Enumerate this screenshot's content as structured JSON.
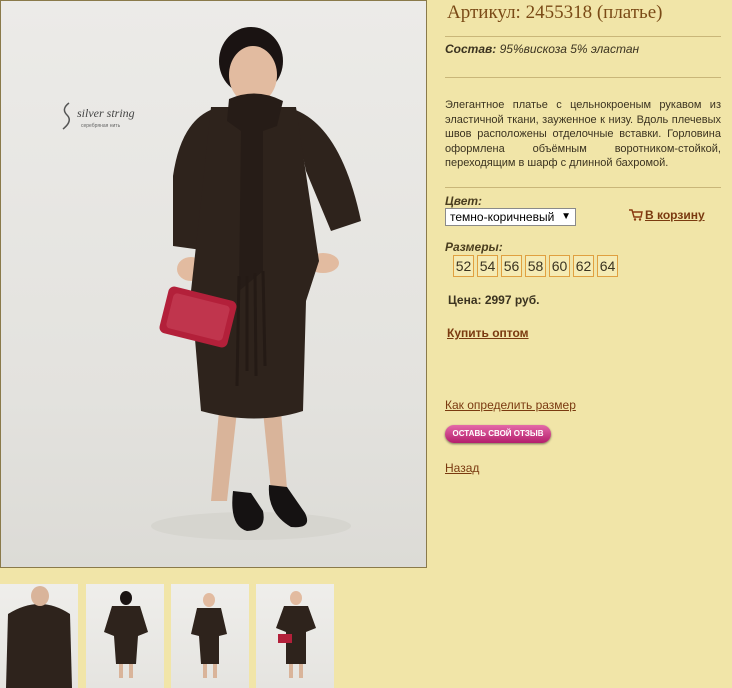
{
  "product": {
    "title": "Артикул: 2455318 (платье)",
    "composition_label": "Состав:",
    "composition_value": "95%вискоза 5% эластан",
    "description": "Элегантное платье с цельнокроеным рукавом из эластичной ткани, зауженное к низу. Вдоль плечевых швов расположены отделочные вставки. Горловина оформлена объёмным воротником-стойкой, переходящим в шарф с длинной бахромой."
  },
  "color": {
    "label": "Цвет:",
    "selected": "темно-коричневый"
  },
  "cart": {
    "label": "В корзину",
    "icon": "cart-icon"
  },
  "sizes": {
    "label": "Размеры:",
    "values": [
      "52",
      "54",
      "56",
      "58",
      "60",
      "62",
      "64"
    ]
  },
  "price": {
    "text": "Цена: 2997 руб."
  },
  "links": {
    "buy_wholesale": "Купить оптом",
    "size_guide": "Как определить размер",
    "review_button": "ОСТАВЬ СВОЙ ОТЗЫВ",
    "back": "Назад"
  },
  "brand": {
    "logo_text": "silver string",
    "logo_subtext": "серебряная нить"
  },
  "colors": {
    "background": "#f1e5a8",
    "title": "#7a4a16",
    "link": "#7a3a10",
    "size_border": "#e0a040",
    "review_button": "#c83a86",
    "dress": "#2e231c"
  }
}
